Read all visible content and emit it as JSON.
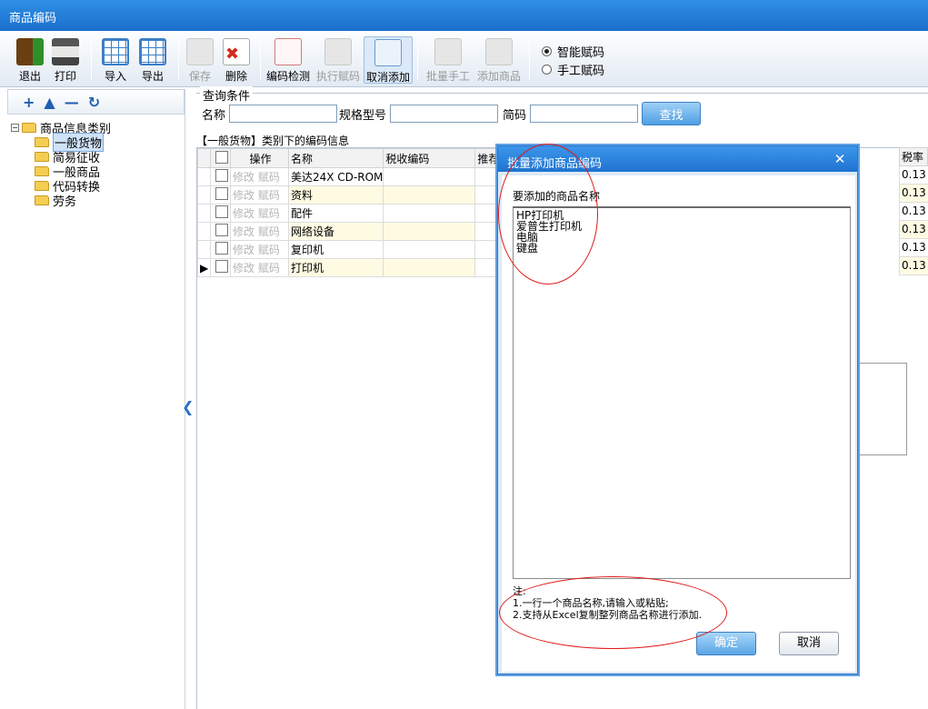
{
  "window": {
    "title": "商品编码"
  },
  "toolbar": {
    "exit": "退出",
    "print": "打印",
    "import": "导入",
    "export": "导出",
    "save": "保存",
    "delete": "删除",
    "code_check": "编码检测",
    "execute_code": "执行赋码",
    "cancel_add": "取消添加",
    "batch_manual": "批量手工",
    "add_product": "添加商品",
    "mode_smart": "智能赋码",
    "mode_manual": "手工赋码"
  },
  "tree": {
    "tools": [
      "+",
      "▲",
      "—",
      "↻"
    ],
    "root": "商品信息类别",
    "items": [
      "一般货物",
      "简易征收",
      "一般商品",
      "代码转换",
      "劳务"
    ],
    "selected": "一般货物"
  },
  "query": {
    "legend": "查询条件",
    "name_label": "名称",
    "spec_label": "规格型号",
    "short_label": "简码",
    "search_button": "查找"
  },
  "grid": {
    "title": "【一般货物】类别下的编码信息",
    "headers": {
      "op": "操作",
      "name": "名称",
      "tax_code": "税收编码",
      "recommend": "推荐",
      "tax_rate": "税率"
    },
    "op_edit": "修改",
    "op_code": "赋码",
    "rows": [
      {
        "name": "美达24X CD-ROM",
        "rate": "0.13"
      },
      {
        "name": "资料",
        "rate": "0.13"
      },
      {
        "name": "配件",
        "rate": "0.13"
      },
      {
        "name": "网络设备",
        "rate": "0.13"
      },
      {
        "name": "复印机",
        "rate": "0.13"
      },
      {
        "name": "打印机",
        "rate": "0.13"
      }
    ]
  },
  "dialog": {
    "title": "批量添加商品编码",
    "close": "✕",
    "label": "要添加的商品名称",
    "textarea_value": "HP打印机\n爱普生打印机\n电脑\n键盘",
    "note_title": "注:",
    "note_1": "1.一行一个商品名称,请输入或粘贴;",
    "note_2": "2.支持从Excel复制整列商品名称进行添加.",
    "ok": "确定",
    "cancel": "取消"
  },
  "colors": {
    "title_bar": "#1a6fcc",
    "annotation": "#e01818",
    "zebra": "#fffbe3"
  }
}
